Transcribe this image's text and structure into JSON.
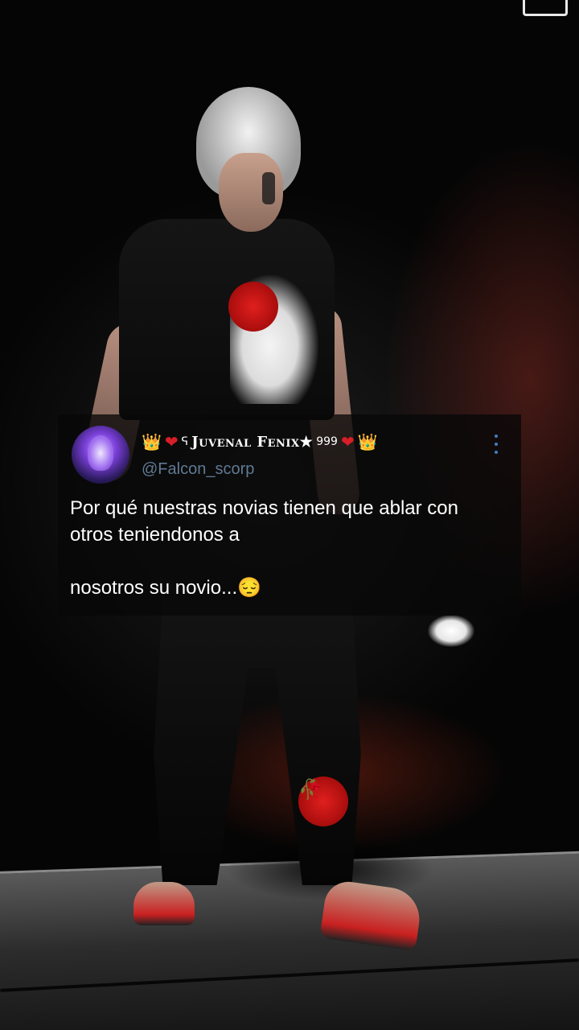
{
  "corner_logo": {
    "icon": "logo-corner-icon"
  },
  "tweet": {
    "author": {
      "display_name": "Juvenal Fenix★",
      "superscript": "999",
      "deco_crown_left": "👑",
      "deco_heart_left": "❤",
      "deco_glyph": "ᕋ",
      "deco_heart_right": "❤",
      "deco_crown_right": "👑",
      "handle": "@Falcon_scorp",
      "avatar_icon": "avatar-icon"
    },
    "text": "Por qué nuestras novias tienen que ablar con otros teniendonos a\n\nnosotros su novio...",
    "emoji_1": "😔",
    "emoji_2": "🥀",
    "menu_icon": "more-options-icon"
  },
  "colors": {
    "handle": "#5f7a94",
    "menu_dots": "#3f7fc0",
    "card_bg": "rgba(8,8,8,0.78)",
    "accent_red": "#d81e28"
  }
}
